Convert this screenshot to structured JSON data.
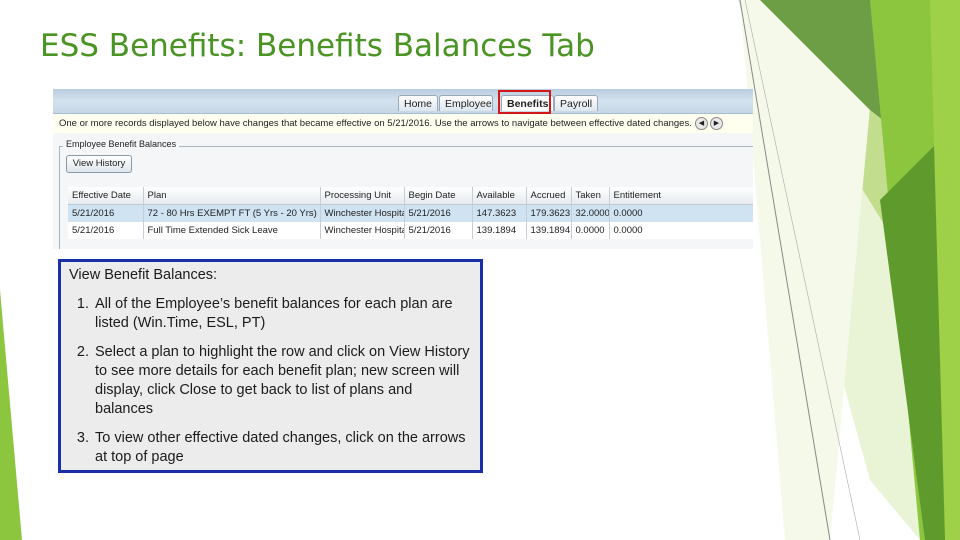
{
  "slide": {
    "title": "ESS Benefits: Benefits Balances Tab",
    "colors": {
      "title": "#4a9424",
      "accent_green": "#8cc63f",
      "callout_border": "#1a2ea8",
      "tab_highlight": "#d01818"
    }
  },
  "app": {
    "tabs": [
      {
        "label": "Home"
      },
      {
        "label": "Employee"
      },
      {
        "label": "Benefits"
      },
      {
        "label": "Payroll"
      }
    ],
    "notice": "One or more records displayed below have changes that became effective on 5/21/2016.  Use the arrows to navigate between effective dated changes.",
    "nav": {
      "prev_icon": "arrow-left-icon",
      "next_icon": "arrow-right-icon"
    },
    "section_legend": "Employee Benefit Balances",
    "view_history_label": "View History",
    "table": {
      "columns": [
        "Effective Date",
        "Plan",
        "Processing Unit",
        "Begin Date",
        "Available",
        "Accrued",
        "Taken",
        "Entitlement"
      ],
      "rows": [
        [
          "5/21/2016",
          "72 - 80 Hrs EXEMPT FT (5 Yrs - 20 Yrs)",
          "Winchester Hospital",
          "5/21/2016",
          "147.3623",
          "179.3623",
          "32.0000",
          "0.0000"
        ],
        [
          "5/21/2016",
          "Full Time Extended Sick Leave",
          "Winchester Hospital",
          "5/21/2016",
          "139.1894",
          "139.1894",
          "0.0000",
          "0.0000"
        ]
      ]
    }
  },
  "callout": {
    "heading": "View Benefit Balances:",
    "items": [
      "All of the Employee’s benefit balances for each plan are listed (Win.Time, ESL, PT)",
      "Select a plan to highlight the row and click on View History to see more details for each benefit plan; new screen will display, click Close to get back to list of plans and balances",
      "To view other effective dated changes, click on the arrows at top of page"
    ]
  }
}
